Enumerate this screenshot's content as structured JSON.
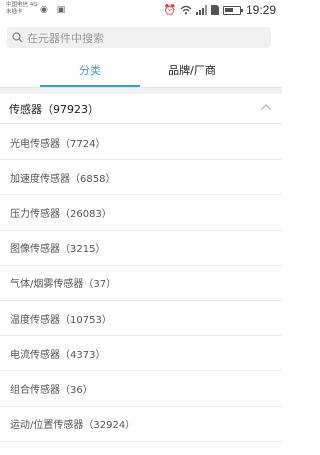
{
  "status_bar": {
    "carrier_line1": "中国电信 4G",
    "carrier_line2": "未插卡",
    "time": "19:29",
    "battery_level": 0.6,
    "icons": [
      "alarm-icon",
      "wifi-icon",
      "signal-icon",
      "sim-icon",
      "battery-icon"
    ]
  },
  "search": {
    "placeholder": "在元器件中搜索"
  },
  "tabs": [
    {
      "label": "分类",
      "active": true
    },
    {
      "label": "品牌/厂商",
      "active": false
    }
  ],
  "accent_color": "#36a4c8",
  "group": {
    "title": "传感器（97923）",
    "expanded": true
  },
  "items": [
    {
      "label": "光电传感器（7724）"
    },
    {
      "label": "加速度传感器（6858）"
    },
    {
      "label": "压力传感器（26083）"
    },
    {
      "label": "图像传感器（3215）"
    },
    {
      "label": "气体/烟雾传感器（37）"
    },
    {
      "label": "温度传感器（10753）"
    },
    {
      "label": "电流传感器（4373）"
    },
    {
      "label": "组合传感器（36）"
    },
    {
      "label": "运动/位置传感器（32924）"
    }
  ]
}
